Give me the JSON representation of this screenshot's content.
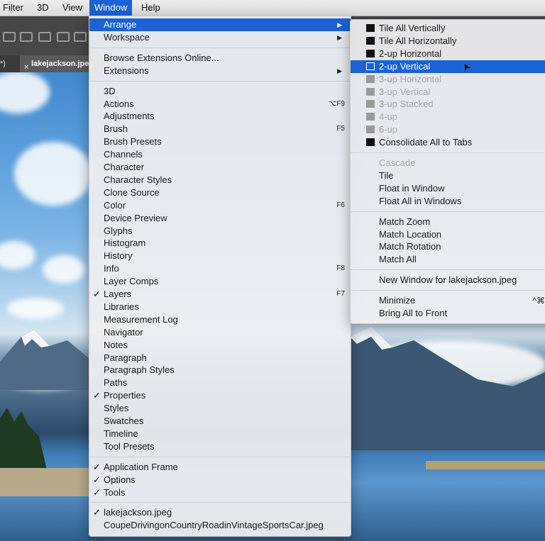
{
  "menubar": {
    "items": [
      "Filter",
      "3D",
      "View",
      "Window",
      "Help"
    ],
    "active": "Window"
  },
  "document_tab": {
    "partial_left": "*)",
    "close_glyph": "×",
    "name": "lakejackson.jpeg"
  },
  "window_menu": {
    "top": [
      {
        "label": "Arrange",
        "submenu": true,
        "highlighted": true
      },
      {
        "label": "Workspace",
        "submenu": true
      }
    ],
    "extensions": [
      {
        "label": "Browse Extensions Online..."
      },
      {
        "label": "Extensions",
        "submenu": true
      }
    ],
    "panels": [
      {
        "label": "3D"
      },
      {
        "label": "Actions",
        "shortcut": "⌥F9"
      },
      {
        "label": "Adjustments"
      },
      {
        "label": "Brush",
        "shortcut": "F5"
      },
      {
        "label": "Brush Presets"
      },
      {
        "label": "Channels"
      },
      {
        "label": "Character"
      },
      {
        "label": "Character Styles"
      },
      {
        "label": "Clone Source"
      },
      {
        "label": "Color",
        "shortcut": "F6"
      },
      {
        "label": "Device Preview"
      },
      {
        "label": "Glyphs"
      },
      {
        "label": "Histogram"
      },
      {
        "label": "History"
      },
      {
        "label": "Info",
        "shortcut": "F8"
      },
      {
        "label": "Layer Comps"
      },
      {
        "label": "Layers",
        "shortcut": "F7",
        "checked": true
      },
      {
        "label": "Libraries"
      },
      {
        "label": "Measurement Log"
      },
      {
        "label": "Navigator"
      },
      {
        "label": "Notes"
      },
      {
        "label": "Paragraph"
      },
      {
        "label": "Paragraph Styles"
      },
      {
        "label": "Paths"
      },
      {
        "label": "Properties",
        "checked": true
      },
      {
        "label": "Styles"
      },
      {
        "label": "Swatches"
      },
      {
        "label": "Timeline"
      },
      {
        "label": "Tool Presets"
      }
    ],
    "frame": [
      {
        "label": "Application Frame",
        "checked": true
      },
      {
        "label": "Options",
        "checked": true
      },
      {
        "label": "Tools",
        "checked": true
      }
    ],
    "documents": [
      {
        "label": "lakejackson.jpeg",
        "checked": true
      },
      {
        "label": "CoupeDrivingonCountryRoadinVintageSportsCar.jpeg"
      }
    ]
  },
  "arrange_menu": {
    "layouts": [
      {
        "label": "Tile All Vertically"
      },
      {
        "label": "Tile All Horizontally"
      },
      {
        "label": "2-up Horizontal"
      },
      {
        "label": "2-up Vertical",
        "highlighted": true
      },
      {
        "label": "3-up Horizontal",
        "disabled": true
      },
      {
        "label": "3-up Vertical",
        "disabled": true
      },
      {
        "label": "3-up Stacked",
        "disabled": true
      },
      {
        "label": "4-up",
        "disabled": true
      },
      {
        "label": "6-up",
        "disabled": true
      },
      {
        "label": "Consolidate All to Tabs"
      }
    ],
    "floating": [
      {
        "label": "Cascade",
        "disabled": true
      },
      {
        "label": "Tile"
      },
      {
        "label": "Float in Window"
      },
      {
        "label": "Float All in Windows"
      }
    ],
    "match": [
      {
        "label": "Match Zoom"
      },
      {
        "label": "Match Location"
      },
      {
        "label": "Match Rotation"
      },
      {
        "label": "Match All"
      }
    ],
    "new_window": [
      {
        "label": "New Window for lakejackson.jpeg"
      }
    ],
    "window_controls": [
      {
        "label": "Minimize",
        "shortcut": "^⌘M"
      },
      {
        "label": "Bring All to Front"
      }
    ]
  },
  "glyphs": {
    "check": "✓",
    "submenu_arrow": "▶",
    "cursor": "➤"
  },
  "colors": {
    "highlight": "#1b62d6",
    "disabled_text": "#a6a6a6"
  }
}
